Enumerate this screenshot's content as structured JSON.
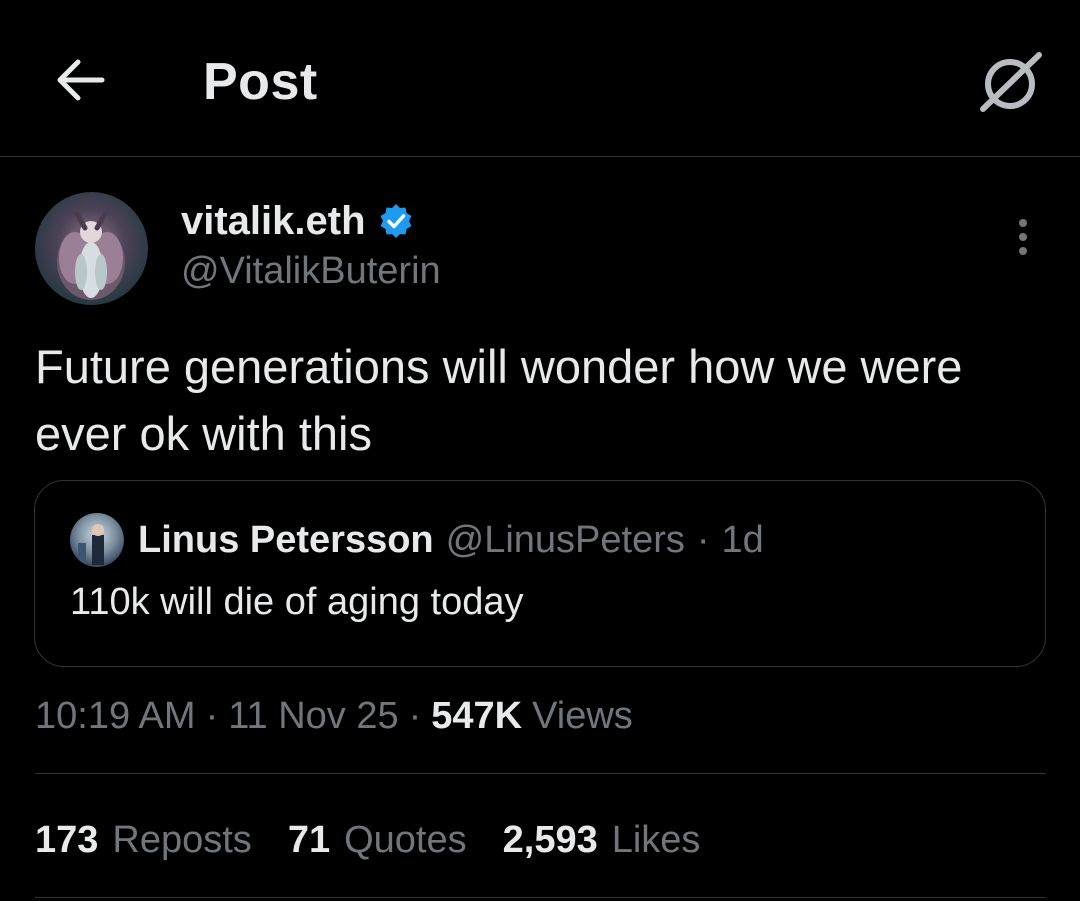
{
  "header": {
    "title": "Post",
    "back_icon": "arrow-left-icon",
    "grok_icon": "grok-slash-circle-icon"
  },
  "author": {
    "name": "vitalik.eth",
    "handle": "@VitalikButerin",
    "verified": true,
    "verified_color": "#1d9bf0"
  },
  "post": {
    "text": "Future generations will wonder how we were ever ok with this"
  },
  "quote": {
    "name": "Linus Petersson",
    "handle": "@LinusPeters",
    "separator": "·",
    "time": "1d",
    "text": "110k will die of aging today"
  },
  "meta": {
    "time": "10:19 AM",
    "separator": "·",
    "date": "11 Nov 25",
    "views_count": "547K",
    "views_label": "Views"
  },
  "stats": [
    {
      "count": "173",
      "label": "Reposts"
    },
    {
      "count": "71",
      "label": "Quotes"
    },
    {
      "count": "2,593",
      "label": "Likes"
    }
  ],
  "colors": {
    "background": "#000000",
    "text": "#e7e9ea",
    "secondary": "#71767b",
    "border": "#2f3336",
    "accent": "#1d9bf0"
  }
}
